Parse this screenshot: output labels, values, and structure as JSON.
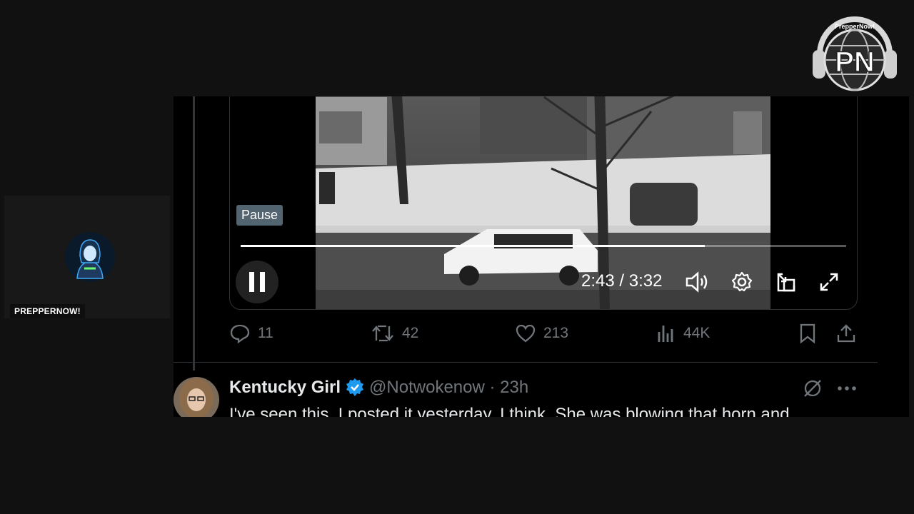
{
  "stream": {
    "logo_text": "PrepperNow!",
    "logo_initials": "PN",
    "streamer_name": "PREPPERNOW!"
  },
  "video": {
    "tooltip": "Pause",
    "time_display": "2:43 / 3:32",
    "progress": 0.766,
    "icons": [
      "pause-icon",
      "volume-icon",
      "settings-icon",
      "pop-out-icon",
      "fullscreen-icon"
    ]
  },
  "tweet": {
    "actions": {
      "replies": "11",
      "retweets": "42",
      "likes": "213",
      "views": "44K"
    }
  },
  "reply": {
    "name": "Kentucky Girl",
    "handle": "@Notwokenow · 23h",
    "text": "I've seen this. I posted it yesterday. I think. She was blowing that horn and",
    "verified_color": "#1d9bf0"
  },
  "colors": {
    "background": "#111111",
    "muted": "#71767b",
    "verified": "#1d9bf0"
  }
}
